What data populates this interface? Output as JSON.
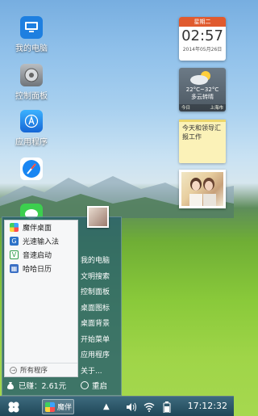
{
  "desktop": {
    "icons": [
      {
        "label": "我的电脑",
        "icon": "my-computer-icon",
        "color": "#1e7fe0"
      },
      {
        "label": "控制面板",
        "icon": "control-panel-icon",
        "color": "#8a8f95"
      },
      {
        "label": "应用程序",
        "icon": "app-store-icon",
        "color": "#1c8bf0"
      },
      {
        "label": "",
        "icon": "safari-icon",
        "color": "#1a86f2"
      },
      {
        "label": "",
        "icon": "messages-icon",
        "color": "#3ccf4e"
      }
    ]
  },
  "widgets": {
    "calendar": {
      "weekday": "星期二",
      "time": "02:57",
      "date": "2014年05月26日"
    },
    "weather": {
      "temp": "22°C~32°C",
      "condition": "多云转晴",
      "today": "今日",
      "city": "上海市"
    },
    "note": {
      "text": "今天和领导汇报工作"
    },
    "photo": {
      "icon": "photo-frame-icon"
    }
  },
  "start_menu": {
    "apps": [
      {
        "label": "魔伴桌面",
        "icon": "moban-desktop-icon",
        "color": "#3aa0e8"
      },
      {
        "label": "光速输入法",
        "icon": "input-method-icon",
        "color": "#2d72c8"
      },
      {
        "label": "音速启动",
        "icon": "quick-launch-icon",
        "color": "#2e9d4a"
      },
      {
        "label": "哈哈日历",
        "icon": "calendar-app-icon",
        "color": "#3a6fc4"
      }
    ],
    "all_programs": "所有程序",
    "links": [
      "我的电脑",
      "文明搜索",
      "控制面板",
      "桌面图标",
      "桌面背景",
      "开始菜单",
      "应用程序",
      "关于..."
    ],
    "earned": "已赚：2.61元",
    "restart": "重启"
  },
  "taskbar": {
    "app_label": "魔伴",
    "clock": "17:12:32"
  }
}
